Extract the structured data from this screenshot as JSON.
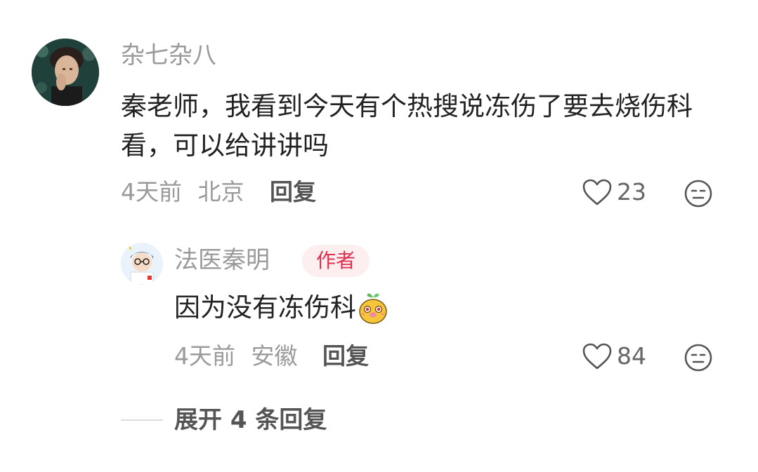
{
  "comment": {
    "username": "杂七杂八",
    "text": "秦老师，我看到今天有个热搜说冻伤了要去烧伤科看，可以给讲讲吗",
    "time": "4天前",
    "location": "北京",
    "reply_label": "回复",
    "like_count": "23"
  },
  "reply": {
    "username": "法医秦明",
    "badge": "作者",
    "text": "因为没有冻伤科",
    "time": "4天前",
    "location": "安徽",
    "reply_label": "回复",
    "like_count": "84"
  },
  "expand": {
    "label": "展开 4 条回复"
  },
  "colors": {
    "badge_bg": "#fdeef0",
    "badge_text": "#e0304e",
    "meta_text": "#9a9a9a"
  },
  "icons": {
    "like": "heart-outline-icon",
    "dislike": "meh-face-icon",
    "emoji": "cute-sprout-emoji"
  }
}
